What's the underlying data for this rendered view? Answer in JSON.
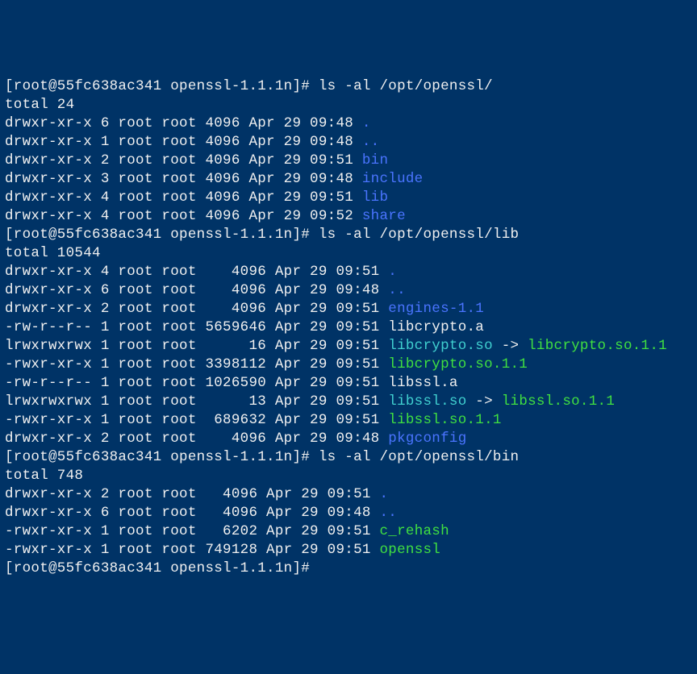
{
  "prompt": "[root@55fc638ac341 openssl-1.1.1n]# ",
  "blocks": [
    {
      "command": "ls -al /opt/openssl/",
      "total": "total 24",
      "entries": [
        {
          "perm": "drwxr-xr-x",
          "n": "6",
          "own": "root",
          "grp": "root",
          "size": "4096",
          "date": "Apr 29 09:48",
          "name": ".",
          "cls": "fg-blue"
        },
        {
          "perm": "drwxr-xr-x",
          "n": "1",
          "own": "root",
          "grp": "root",
          "size": "4096",
          "date": "Apr 29 09:48",
          "name": "..",
          "cls": "fg-blue"
        },
        {
          "perm": "drwxr-xr-x",
          "n": "2",
          "own": "root",
          "grp": "root",
          "size": "4096",
          "date": "Apr 29 09:51",
          "name": "bin",
          "cls": "fg-blue"
        },
        {
          "perm": "drwxr-xr-x",
          "n": "3",
          "own": "root",
          "grp": "root",
          "size": "4096",
          "date": "Apr 29 09:48",
          "name": "include",
          "cls": "fg-blue"
        },
        {
          "perm": "drwxr-xr-x",
          "n": "4",
          "own": "root",
          "grp": "root",
          "size": "4096",
          "date": "Apr 29 09:51",
          "name": "lib",
          "cls": "fg-blue"
        },
        {
          "perm": "drwxr-xr-x",
          "n": "4",
          "own": "root",
          "grp": "root",
          "size": "4096",
          "date": "Apr 29 09:52",
          "name": "share",
          "cls": "fg-blue"
        }
      ],
      "size_width": 4
    },
    {
      "command": "ls -al /opt/openssl/lib",
      "total": "total 10544",
      "entries": [
        {
          "perm": "drwxr-xr-x",
          "n": "4",
          "own": "root",
          "grp": "root",
          "size": "4096",
          "date": "Apr 29 09:51",
          "name": ".",
          "cls": "fg-blue"
        },
        {
          "perm": "drwxr-xr-x",
          "n": "6",
          "own": "root",
          "grp": "root",
          "size": "4096",
          "date": "Apr 29 09:48",
          "name": "..",
          "cls": "fg-blue"
        },
        {
          "perm": "drwxr-xr-x",
          "n": "2",
          "own": "root",
          "grp": "root",
          "size": "4096",
          "date": "Apr 29 09:51",
          "name": "engines-1.1",
          "cls": "fg-blue"
        },
        {
          "perm": "-rw-r--r--",
          "n": "1",
          "own": "root",
          "grp": "root",
          "size": "5659646",
          "date": "Apr 29 09:51",
          "name": "libcrypto.a",
          "cls": "fg-white"
        },
        {
          "perm": "lrwxrwxrwx",
          "n": "1",
          "own": "root",
          "grp": "root",
          "size": "16",
          "date": "Apr 29 09:51",
          "name": "libcrypto.so",
          "cls": "fg-cyan",
          "arrow": " -> ",
          "target": "libcrypto.so.1.1",
          "tcls": "fg-green"
        },
        {
          "perm": "-rwxr-xr-x",
          "n": "1",
          "own": "root",
          "grp": "root",
          "size": "3398112",
          "date": "Apr 29 09:51",
          "name": "libcrypto.so.1.1",
          "cls": "fg-green"
        },
        {
          "perm": "-rw-r--r--",
          "n": "1",
          "own": "root",
          "grp": "root",
          "size": "1026590",
          "date": "Apr 29 09:51",
          "name": "libssl.a",
          "cls": "fg-white"
        },
        {
          "perm": "lrwxrwxrwx",
          "n": "1",
          "own": "root",
          "grp": "root",
          "size": "13",
          "date": "Apr 29 09:51",
          "name": "libssl.so",
          "cls": "fg-cyan",
          "arrow": " -> ",
          "target": "libssl.so.1.1",
          "tcls": "fg-green"
        },
        {
          "perm": "-rwxr-xr-x",
          "n": "1",
          "own": "root",
          "grp": "root",
          "size": "689632",
          "date": "Apr 29 09:51",
          "name": "libssl.so.1.1",
          "cls": "fg-green"
        },
        {
          "perm": "drwxr-xr-x",
          "n": "2",
          "own": "root",
          "grp": "root",
          "size": "4096",
          "date": "Apr 29 09:48",
          "name": "pkgconfig",
          "cls": "fg-blue"
        }
      ],
      "size_width": 7
    },
    {
      "command": "ls -al /opt/openssl/bin",
      "total": "total 748",
      "entries": [
        {
          "perm": "drwxr-xr-x",
          "n": "2",
          "own": "root",
          "grp": "root",
          "size": "4096",
          "date": "Apr 29 09:51",
          "name": ".",
          "cls": "fg-blue"
        },
        {
          "perm": "drwxr-xr-x",
          "n": "6",
          "own": "root",
          "grp": "root",
          "size": "4096",
          "date": "Apr 29 09:48",
          "name": "..",
          "cls": "fg-blue"
        },
        {
          "perm": "-rwxr-xr-x",
          "n": "1",
          "own": "root",
          "grp": "root",
          "size": "6202",
          "date": "Apr 29 09:51",
          "name": "c_rehash",
          "cls": "fg-green"
        },
        {
          "perm": "-rwxr-xr-x",
          "n": "1",
          "own": "root",
          "grp": "root",
          "size": "749128",
          "date": "Apr 29 09:51",
          "name": "openssl",
          "cls": "fg-green"
        }
      ],
      "size_width": 6
    }
  ]
}
